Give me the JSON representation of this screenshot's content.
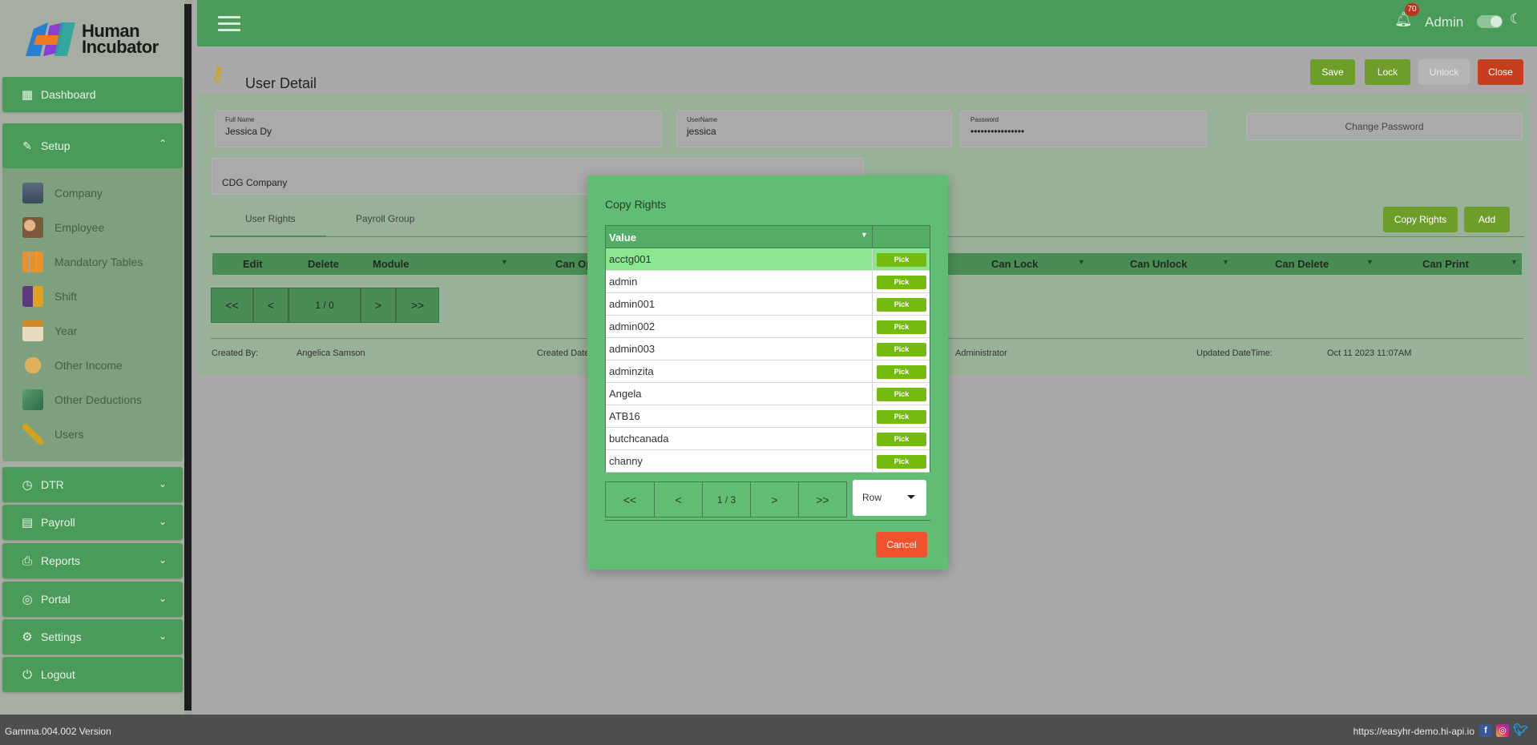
{
  "app": {
    "logo_line1": "Human",
    "logo_line2": "Incubator",
    "version": "Gamma.004.002 Version",
    "url": "https://easyhr-demo.hi-api.io"
  },
  "topbar": {
    "notifications": "70",
    "user": "Admin"
  },
  "sidebar": {
    "dashboard": "Dashboard",
    "setup": "Setup",
    "setup_items": [
      {
        "label": "Company",
        "icon": "building-icon"
      },
      {
        "label": "Employee",
        "icon": "people-icon"
      },
      {
        "label": "Mandatory Tables",
        "icon": "grid-icon"
      },
      {
        "label": "Shift",
        "icon": "shift-icon"
      },
      {
        "label": "Year",
        "icon": "calendar-icon"
      },
      {
        "label": "Other Income",
        "icon": "money-bag-icon"
      },
      {
        "label": "Other Deductions",
        "icon": "money-icon"
      },
      {
        "label": "Users",
        "icon": "key-icon"
      }
    ],
    "dtr": "DTR",
    "payroll": "Payroll",
    "reports": "Reports",
    "portal": "Portal",
    "settings": "Settings",
    "logout": "Logout"
  },
  "page": {
    "title": "User Detail",
    "buttons": {
      "save": "Save",
      "lock": "Lock",
      "unlock": "Unlock",
      "close": "Close",
      "copy_rights": "Copy Rights",
      "add": "Add",
      "change_password": "Change Password"
    },
    "fields": {
      "full_name_label": "Full Name",
      "full_name": "Jessica Dy",
      "username_label": "UserName",
      "username": "jessica",
      "password_label": "Password",
      "password": "••••••••••••••••",
      "company": "CDG Company"
    },
    "tabs": [
      "User Rights",
      "Payroll Group"
    ],
    "grid_columns": [
      "Edit",
      "Delete",
      "Module",
      "Can Op",
      "Can Lock",
      "Can Unlock",
      "Can Delete",
      "Can Print"
    ],
    "pager": {
      "first": "<<",
      "prev": "<",
      "page": "1 / 0",
      "next": ">",
      "last": ">>"
    },
    "audit": {
      "created_by_label": "Created By:",
      "created_by": "Angelica Samson",
      "created_dt_label": "Created Date",
      "updated_by": "Administrator",
      "updated_dt_label": "Updated DateTime:",
      "updated_dt": "Oct 11 2023 11:07AM"
    }
  },
  "modal": {
    "title": "Copy Rights",
    "column": "Value",
    "pick_label": "Pick",
    "rows": [
      "acctg001",
      "admin",
      "admin001",
      "admin002",
      "admin003",
      "adminzita",
      "Angela",
      "ATB16",
      "butchcanada",
      "channy"
    ],
    "selected_index": 0,
    "pager": {
      "first": "<<",
      "prev": "<",
      "page": "1 / 3",
      "next": ">",
      "last": ">>"
    },
    "row_select": "Row",
    "cancel": "Cancel"
  },
  "colors": {
    "green": "#4a9a5a",
    "modal": "#62bd74",
    "pick": "#74ba0f",
    "cancel": "#f0522b",
    "close": "#c73d1e"
  }
}
